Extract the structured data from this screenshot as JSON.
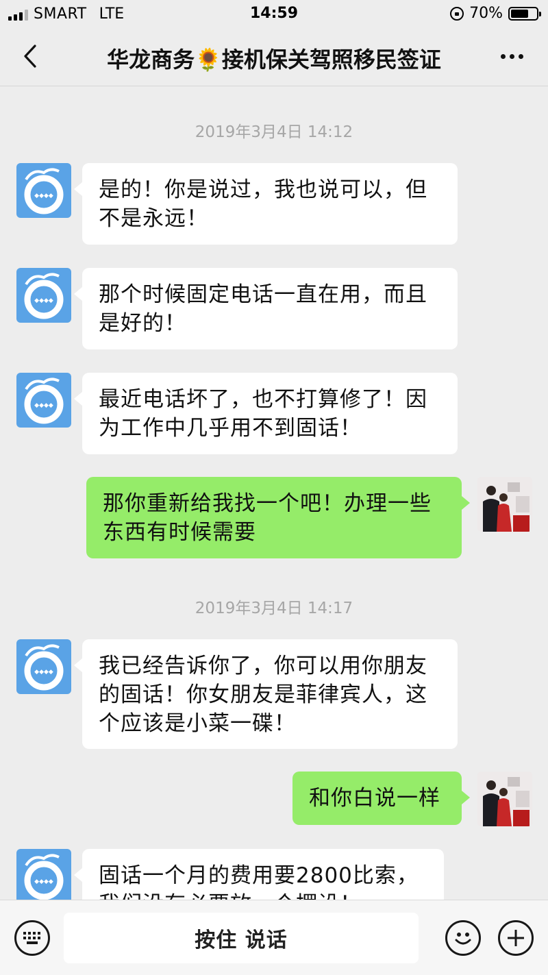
{
  "status_bar": {
    "carrier": "SMART",
    "network": "LTE",
    "time": "14:59",
    "battery": "70%",
    "battery_level": 0.7
  },
  "nav": {
    "title": "华龙商务🌻接机保关驾照移民签证",
    "back_icon": "chevron-left-icon",
    "more_icon": "more-dots-icon"
  },
  "chat": {
    "timestamps": [
      "2019年3月4日 14:12",
      "2019年3月4日 14:17"
    ],
    "messages": [
      {
        "from": "other",
        "lines": [
          "是的！你是说过，我也说可以，但",
          "不是永远！"
        ]
      },
      {
        "from": "other",
        "lines": [
          "那个时候固定电话一直在用，而且",
          "是好的！"
        ]
      },
      {
        "from": "other",
        "lines": [
          "最近电话坏了，也不打算修了！因",
          "为工作中几乎用不到固话！"
        ]
      },
      {
        "from": "me",
        "lines": [
          "那你重新给我找一个吧！办理一些",
          "东西有时候需要"
        ]
      },
      {
        "from": "other",
        "lines": [
          "我已经告诉你了，你可以用你朋友",
          "的固话！你女朋友是菲律宾人，这",
          "个应该是小菜一碟！"
        ]
      },
      {
        "from": "me",
        "lines": [
          "和你白说一样"
        ]
      },
      {
        "from": "other",
        "lines": [
          "固话一个月的费用要2800比索，",
          "我们没有必要放一个摆设！"
        ]
      }
    ]
  },
  "input_bar": {
    "hold_to_talk": "按住 说话",
    "keyboard_icon": "keyboard-icon",
    "emoji_icon": "emoji-icon",
    "plus_icon": "plus-icon"
  },
  "colors": {
    "background": "#ededed",
    "incoming_bubble": "#ffffff",
    "outgoing_bubble": "#95ec69",
    "timestamp": "#a6a6a6"
  }
}
